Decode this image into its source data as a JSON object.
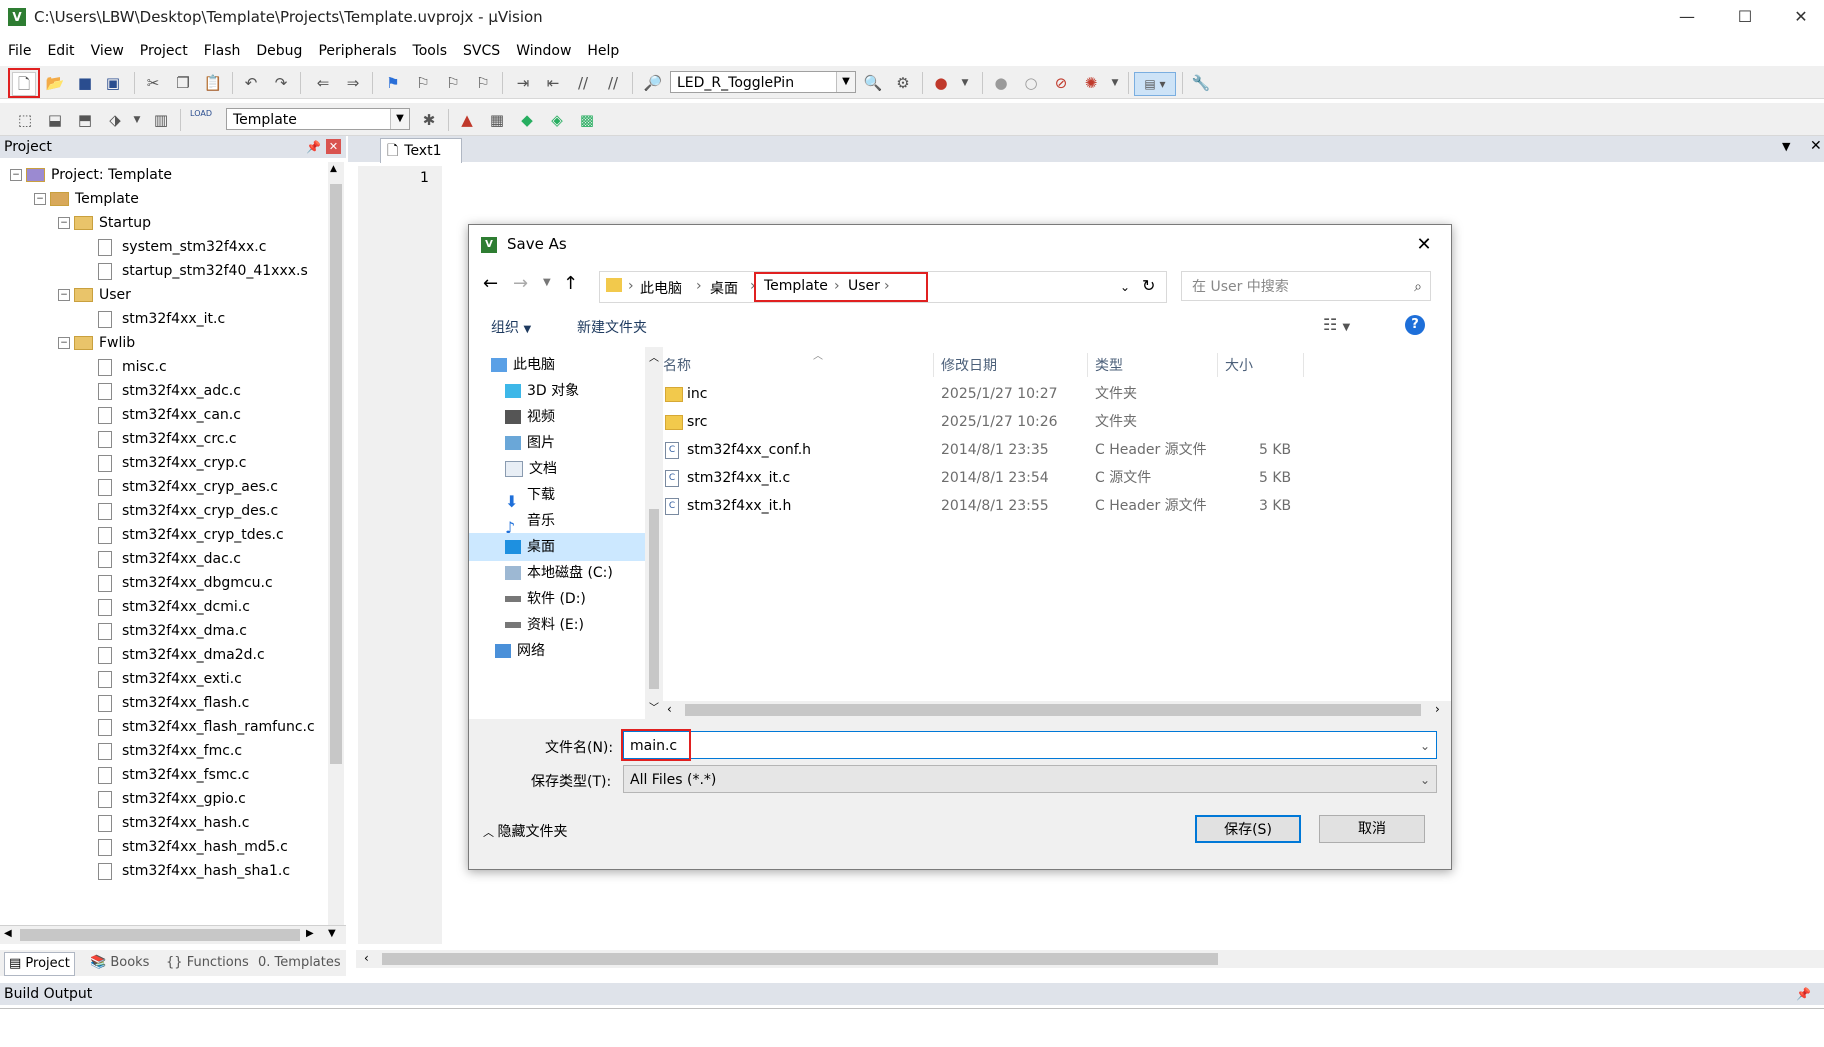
{
  "window": {
    "title": "C:\\Users\\LBW\\Desktop\\Template\\Projects\\Template.uvprojx - µVision",
    "app_icon": "uvision-logo",
    "controls": [
      "—",
      "☐",
      "✕"
    ]
  },
  "menubar": [
    "File",
    "Edit",
    "View",
    "Project",
    "Flash",
    "Debug",
    "Peripherals",
    "Tools",
    "SVCS",
    "Window",
    "Help"
  ],
  "toolbar1": {
    "target_combo": "LED_R_TogglePin"
  },
  "toolbar2": {
    "target_combo": "Template",
    "load_label": "LOAD"
  },
  "project_panel": {
    "header": "Project",
    "tree": [
      {
        "label": "Project: Template",
        "level": 0,
        "kind": "project",
        "expanded": true
      },
      {
        "label": "Template",
        "level": 1,
        "kind": "target",
        "expanded": true
      },
      {
        "label": "Startup",
        "level": 2,
        "kind": "folder",
        "expanded": true
      },
      {
        "label": "system_stm32f4xx.c",
        "level": 3,
        "kind": "file"
      },
      {
        "label": "startup_stm32f40_41xxx.s",
        "level": 3,
        "kind": "file"
      },
      {
        "label": "User",
        "level": 2,
        "kind": "folder",
        "expanded": true
      },
      {
        "label": "stm32f4xx_it.c",
        "level": 3,
        "kind": "file"
      },
      {
        "label": "Fwlib",
        "level": 2,
        "kind": "folder",
        "expanded": true
      },
      {
        "label": "misc.c",
        "level": 3,
        "kind": "file"
      },
      {
        "label": "stm32f4xx_adc.c",
        "level": 3,
        "kind": "file"
      },
      {
        "label": "stm32f4xx_can.c",
        "level": 3,
        "kind": "file"
      },
      {
        "label": "stm32f4xx_crc.c",
        "level": 3,
        "kind": "file"
      },
      {
        "label": "stm32f4xx_cryp.c",
        "level": 3,
        "kind": "file"
      },
      {
        "label": "stm32f4xx_cryp_aes.c",
        "level": 3,
        "kind": "file"
      },
      {
        "label": "stm32f4xx_cryp_des.c",
        "level": 3,
        "kind": "file"
      },
      {
        "label": "stm32f4xx_cryp_tdes.c",
        "level": 3,
        "kind": "file"
      },
      {
        "label": "stm32f4xx_dac.c",
        "level": 3,
        "kind": "file"
      },
      {
        "label": "stm32f4xx_dbgmcu.c",
        "level": 3,
        "kind": "file"
      },
      {
        "label": "stm32f4xx_dcmi.c",
        "level": 3,
        "kind": "file"
      },
      {
        "label": "stm32f4xx_dma.c",
        "level": 3,
        "kind": "file"
      },
      {
        "label": "stm32f4xx_dma2d.c",
        "level": 3,
        "kind": "file"
      },
      {
        "label": "stm32f4xx_exti.c",
        "level": 3,
        "kind": "file"
      },
      {
        "label": "stm32f4xx_flash.c",
        "level": 3,
        "kind": "file"
      },
      {
        "label": "stm32f4xx_flash_ramfunc.c",
        "level": 3,
        "kind": "file"
      },
      {
        "label": "stm32f4xx_fmc.c",
        "level": 3,
        "kind": "file"
      },
      {
        "label": "stm32f4xx_fsmc.c",
        "level": 3,
        "kind": "file"
      },
      {
        "label": "stm32f4xx_gpio.c",
        "level": 3,
        "kind": "file"
      },
      {
        "label": "stm32f4xx_hash.c",
        "level": 3,
        "kind": "file"
      },
      {
        "label": "stm32f4xx_hash_md5.c",
        "level": 3,
        "kind": "file"
      },
      {
        "label": "stm32f4xx_hash_sha1.c",
        "level": 3,
        "kind": "file"
      }
    ],
    "tabs": [
      "Project",
      "Books",
      "Functions",
      "Templates"
    ]
  },
  "editor": {
    "tab": "Text1",
    "line_number": "1"
  },
  "build_output": {
    "header": "Build Output"
  },
  "dialog": {
    "title": "Save As",
    "breadcrumb": [
      "此电脑",
      "桌面",
      "Template",
      "User"
    ],
    "search_placeholder": "在 User 中搜索",
    "organize": "组织",
    "new_folder": "新建文件夹",
    "nav_items": [
      {
        "label": "此电脑",
        "icon": "computer-icon"
      },
      {
        "label": "3D 对象",
        "icon": "3d-objects-icon"
      },
      {
        "label": "视频",
        "icon": "video-icon"
      },
      {
        "label": "图片",
        "icon": "pictures-icon"
      },
      {
        "label": "文档",
        "icon": "documents-icon"
      },
      {
        "label": "下载",
        "icon": "download-icon"
      },
      {
        "label": "音乐",
        "icon": "music-icon"
      },
      {
        "label": "桌面",
        "icon": "desktop-icon",
        "selected": true
      },
      {
        "label": "本地磁盘 (C:)",
        "icon": "drive-c-icon"
      },
      {
        "label": "软件 (D:)",
        "icon": "drive-icon"
      },
      {
        "label": "资料 (E:)",
        "icon": "drive-icon"
      },
      {
        "label": "网络",
        "icon": "network-icon"
      }
    ],
    "columns": [
      "名称",
      "修改日期",
      "类型",
      "大小"
    ],
    "files": [
      {
        "name": "inc",
        "date": "2025/1/27 10:27",
        "type": "文件夹",
        "size": "",
        "kind": "folder"
      },
      {
        "name": "src",
        "date": "2025/1/27 10:26",
        "type": "文件夹",
        "size": "",
        "kind": "folder"
      },
      {
        "name": "stm32f4xx_conf.h",
        "date": "2014/8/1 23:35",
        "type": "C Header 源文件",
        "size": "5 KB",
        "kind": "c"
      },
      {
        "name": "stm32f4xx_it.c",
        "date": "2014/8/1 23:54",
        "type": "C 源文件",
        "size": "5 KB",
        "kind": "c"
      },
      {
        "name": "stm32f4xx_it.h",
        "date": "2014/8/1 23:55",
        "type": "C Header 源文件",
        "size": "3 KB",
        "kind": "c"
      }
    ],
    "filename_label": "文件名(N):",
    "filename_value": "main.c",
    "filetype_label": "保存类型(T):",
    "filetype_value": "All Files (*.*)",
    "hide_folders": "隐藏文件夹",
    "save_button": "保存(S)",
    "cancel_button": "取消",
    "help_glyph": "?"
  },
  "accent_colors": {
    "highlight_red": "#e02020",
    "selection_blue": "#cce8ff",
    "focus_blue": "#0078d7"
  }
}
